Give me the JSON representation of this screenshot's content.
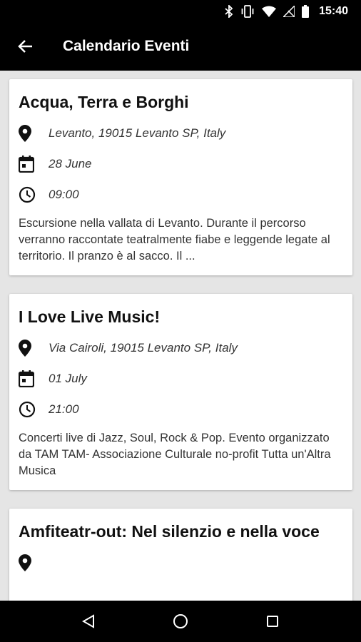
{
  "status_bar": {
    "time": "15:40",
    "icons": [
      "bluetooth-icon",
      "vibrate-icon",
      "wifi-icon",
      "no-signal-icon",
      "battery-icon"
    ]
  },
  "app_bar": {
    "title": "Calendario Eventi",
    "back_icon": "arrow-back-icon"
  },
  "events": [
    {
      "title": "Acqua, Terra e Borghi",
      "location": "Levanto, 19015 Levanto SP, Italy",
      "date": "28 June",
      "time": "09:00",
      "description": "Escursione nella vallata di Levanto. Durante il percorso verranno raccontate teatralmente fiabe e leggende legate al territorio. Il pranzo è al sacco. Il ..."
    },
    {
      "title": "I Love Live Music!",
      "location": "Via Cairoli, 19015 Levanto SP, Italy",
      "date": "01 July",
      "time": "21:00",
      "description": "Concerti live di Jazz, Soul, Rock & Pop. Evento organizzato da TAM TAM- Associazione Culturale no-profit Tutta un'Altra Musica"
    },
    {
      "title": "Amfiteatr-out: Nel silenzio e nella voce"
    }
  ],
  "nav_bar": {
    "icons": [
      "back-triangle-icon",
      "home-circle-icon",
      "recents-square-icon"
    ]
  }
}
